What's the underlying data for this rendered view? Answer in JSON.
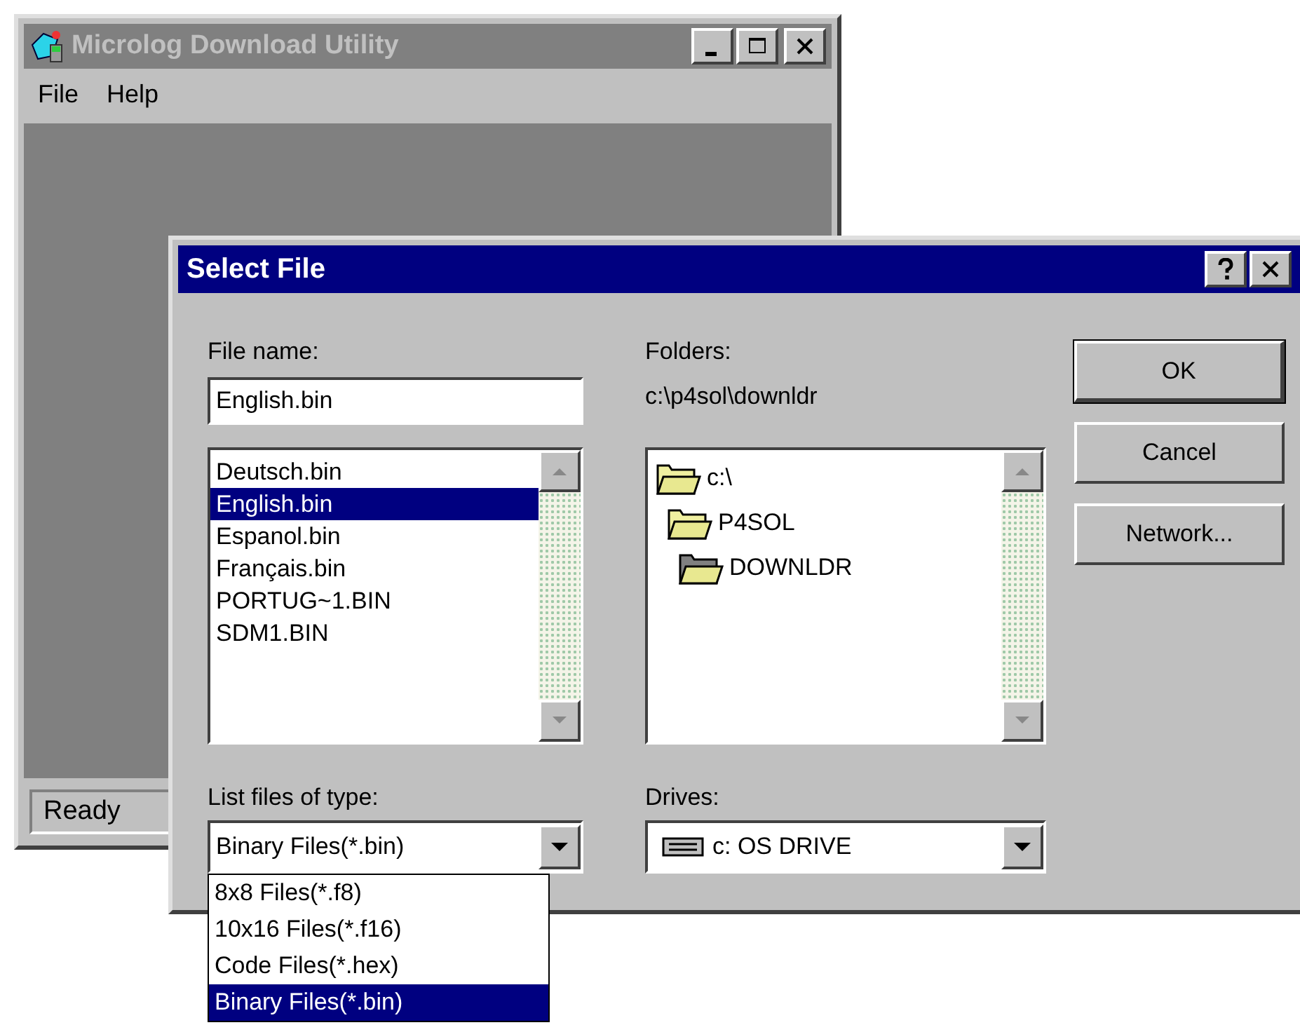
{
  "main_window": {
    "title": "Microlog Download Utility",
    "active": false,
    "menu": [
      "File",
      "Help"
    ],
    "status_bar": "Ready"
  },
  "dialog": {
    "title": "Select File",
    "active": true,
    "file_name": {
      "label": "File name:",
      "value": "English.bin"
    },
    "files": [
      {
        "name": "Deutsch.bin",
        "selected": false
      },
      {
        "name": "English.bin",
        "selected": true
      },
      {
        "name": "Espanol.bin",
        "selected": false
      },
      {
        "name": "Français.bin",
        "selected": false
      },
      {
        "name": "PORTUG~1.BIN",
        "selected": false
      },
      {
        "name": "SDM1.BIN",
        "selected": false
      }
    ],
    "folders": {
      "label": "Folders:",
      "path": "c:\\p4sol\\downldr",
      "items": [
        {
          "name": "c:\\",
          "selected": false,
          "children": [
            {
              "name": "P4SOL",
              "selected": false,
              "children": [
                {
                  "name": "DOWNLDR",
                  "selected": true
                }
              ]
            }
          ]
        }
      ]
    },
    "file_type": {
      "label": "List files of type:",
      "value": "Binary Files(*.bin)",
      "expanded": true,
      "options": [
        {
          "name": "8x8 Files(*.f8)",
          "selected": false
        },
        {
          "name": "10x16 Files(*.f16)",
          "selected": false
        },
        {
          "name": "Code Files(*.hex)",
          "selected": false
        },
        {
          "name": "Binary Files(*.bin)",
          "selected": true
        }
      ]
    },
    "drives": {
      "label": "Drives:",
      "value": "c: OS DRIVE"
    },
    "buttons": [
      {
        "label": "OK",
        "default": true
      },
      {
        "label": "Cancel",
        "default": false
      },
      {
        "label": "Network...",
        "default": false
      }
    ]
  }
}
